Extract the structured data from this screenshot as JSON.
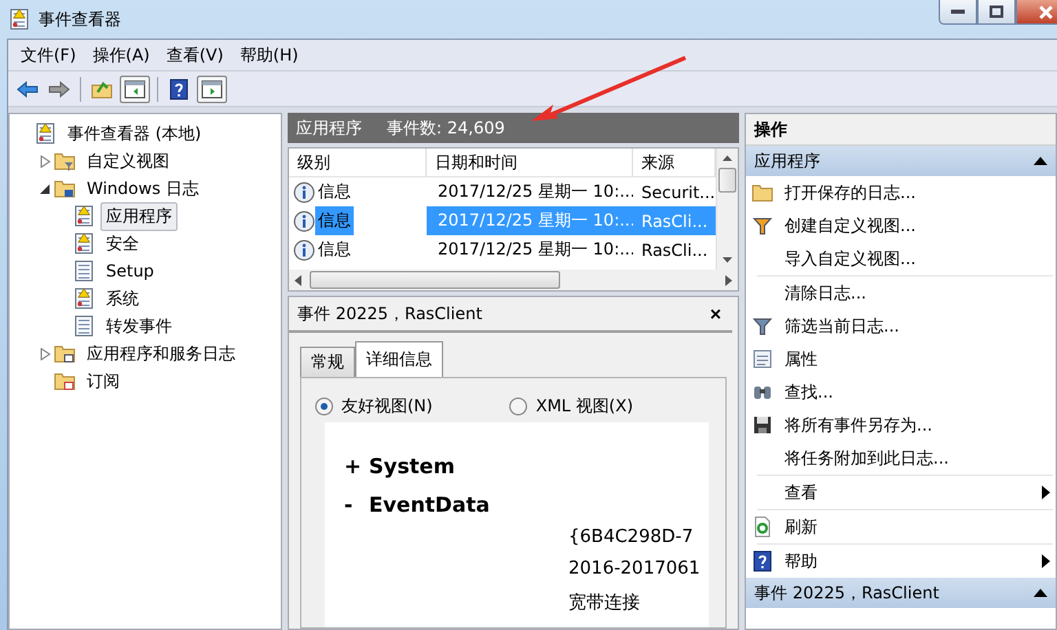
{
  "window": {
    "title": "事件查看器"
  },
  "menu": [
    "文件(F)",
    "操作(A)",
    "查看(V)",
    "帮助(H)"
  ],
  "toolbar": [
    {
      "kind": "back"
    },
    {
      "kind": "forward"
    },
    {
      "kind": "sep"
    },
    {
      "kind": "up"
    },
    {
      "kind": "pane-left"
    },
    {
      "kind": "sep"
    },
    {
      "kind": "help"
    },
    {
      "kind": "pane-right"
    }
  ],
  "tree": [
    {
      "label": "事件查看器 (本地)",
      "kind": "log-warning",
      "selected": false,
      "children": [
        {
          "label": "自定义视图",
          "kind": "folder-filter",
          "expanded": false,
          "selected": false
        },
        {
          "label": "Windows 日志",
          "kind": "folder-windows",
          "expanded": true,
          "selected": false,
          "children": [
            {
              "label": "应用程序",
              "kind": "log-warning",
              "selected": true
            },
            {
              "label": "安全",
              "kind": "log-warning",
              "selected": false
            },
            {
              "label": "Setup",
              "kind": "log",
              "selected": false
            },
            {
              "label": "系统",
              "kind": "log-warning",
              "selected": false
            },
            {
              "label": "转发事件",
              "kind": "log",
              "selected": false
            }
          ]
        },
        {
          "label": "应用程序和服务日志",
          "kind": "folder-window",
          "expanded": false,
          "selected": false
        },
        {
          "label": "订阅",
          "kind": "folder-calendar",
          "selected": false
        }
      ]
    }
  ],
  "log_header": {
    "name": "应用程序",
    "count": "事件数: 24,609"
  },
  "table": {
    "columns": [
      "级别",
      "日期和时间",
      "来源"
    ],
    "rows": [
      {
        "level": "信息",
        "datetime": "2017/12/25 星期一 10:...",
        "source": "Securit...",
        "selected": false
      },
      {
        "level": "信息",
        "datetime": "2017/12/25 星期一 10:...",
        "source": "RasCli...",
        "selected": true
      },
      {
        "level": "信息",
        "datetime": "2017/12/25 星期一 10:...",
        "source": "RasCli...",
        "selected": false
      }
    ]
  },
  "details": {
    "title": "事件 20225，RasClient",
    "close": "×",
    "tabs": [
      {
        "label": "常规",
        "selected": false
      },
      {
        "label": "详细信息",
        "selected": true
      }
    ],
    "views": [
      {
        "label": "友好视图(N)",
        "selected": true
      },
      {
        "label": "XML 视图(X)",
        "selected": false
      }
    ],
    "sections": [
      {
        "sign": "+",
        "label": "System"
      },
      {
        "sign": "-",
        "label": "EventData"
      }
    ],
    "values": [
      "{6B4C298D-7",
      "2016-2017061",
      "宽带连接"
    ]
  },
  "actions": {
    "title": "操作",
    "sections": [
      {
        "title": "应用程序",
        "expanded": true,
        "items": [
          {
            "kind": "folder-open",
            "label": "打开保存的日志..."
          },
          {
            "kind": "filter-create",
            "label": "创建自定义视图..."
          },
          {
            "kind": "plain",
            "label": "导入自定义视图..."
          },
          {
            "kind": "separator"
          },
          {
            "kind": "plain",
            "label": "清除日志..."
          },
          {
            "kind": "filter",
            "label": "筛选当前日志..."
          },
          {
            "kind": "properties",
            "label": "属性"
          },
          {
            "kind": "binoculars",
            "label": "查找..."
          },
          {
            "kind": "save",
            "label": "将所有事件另存为..."
          },
          {
            "kind": "plain",
            "label": "将任务附加到此日志..."
          },
          {
            "kind": "separator"
          },
          {
            "kind": "submenu",
            "label": "查看"
          },
          {
            "kind": "separator"
          },
          {
            "kind": "refresh",
            "label": "刷新"
          },
          {
            "kind": "separator"
          },
          {
            "kind": "help-submenu",
            "label": "帮助"
          }
        ]
      },
      {
        "title": "事件 20225，RasClient",
        "expanded": true
      }
    ]
  }
}
